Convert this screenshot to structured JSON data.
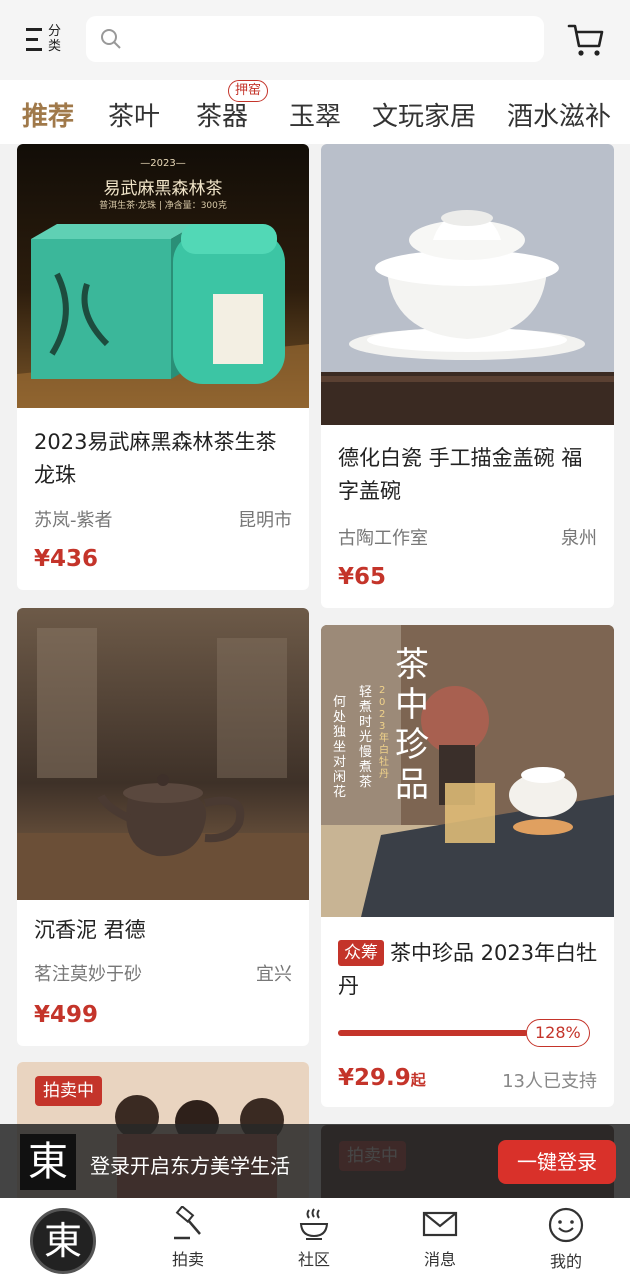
{
  "header": {
    "category_label": "分类",
    "search_placeholder": ""
  },
  "tabs": [
    {
      "label": "推荐",
      "active": true
    },
    {
      "label": "茶叶",
      "active": false
    },
    {
      "label": "茶器",
      "active": false,
      "badge": "押窑"
    },
    {
      "label": "玉翠",
      "active": false
    },
    {
      "label": "文玩家居",
      "active": false
    },
    {
      "label": "酒水滋补",
      "active": false
    }
  ],
  "products": [
    {
      "title": "2023易武麻黑森林茶生茶龙珠",
      "shop": "苏岚-紫者",
      "city": "昆明市",
      "price": "¥436",
      "image_text": {
        "year": "—2023—",
        "name": "易武麻黑森林茶",
        "sub": "普洱生茶·龙珠 | 净含量：300克"
      }
    },
    {
      "title": "德化白瓷 手工描金盖碗 福字盖碗",
      "shop": "古陶工作室",
      "city": "泉州",
      "price": "¥65"
    },
    {
      "title": "沉香泥 君德",
      "shop": "茗注莫妙于砂",
      "city": "宜兴",
      "price": "¥499"
    },
    {
      "tag": "众筹",
      "title": "茶中珍品 2023年白牡丹",
      "progress": 1.28,
      "progress_label": "128%",
      "price": "¥29.9",
      "price_suffix": "起",
      "supporters": "13人已支持",
      "image_text": {
        "big": "茶中珍品",
        "vertical1": "轻煮时光慢煮茶",
        "vertical2": "2023年白牡丹",
        "vertical3": "何处独坐对闲花"
      }
    }
  ],
  "auction_label": "拍卖中",
  "login_banner": {
    "logo": "東",
    "text": "登录开启东方美学生活",
    "button": "一键登录"
  },
  "bottom_nav": {
    "home_logo": "東",
    "items": [
      {
        "label": "拍卖",
        "icon": "gavel-icon"
      },
      {
        "label": "社区",
        "icon": "tea-bowl-icon"
      },
      {
        "label": "消息",
        "icon": "mail-icon"
      },
      {
        "label": "我的",
        "icon": "smiley-icon"
      }
    ]
  },
  "colors": {
    "accent": "#c4342a",
    "active_tab": "#a0794a"
  }
}
